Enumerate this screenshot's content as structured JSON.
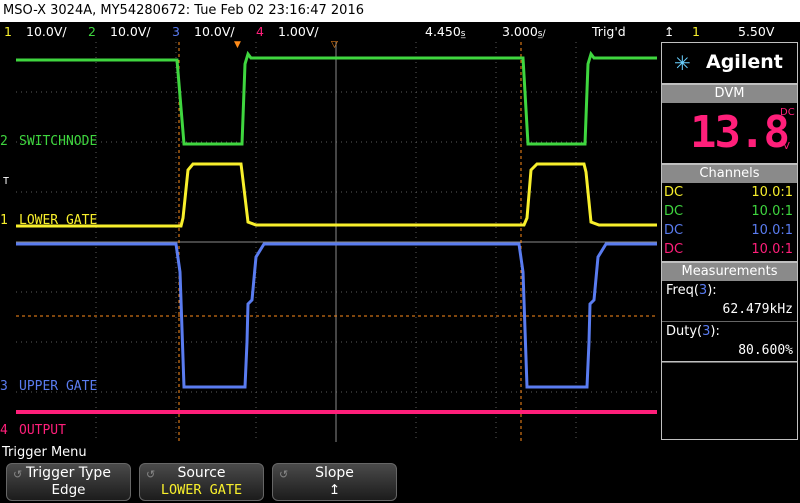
{
  "title": "MSO-X 3024A, MY54280672: Tue Feb 02 23:16:47 2016",
  "status": {
    "ch1": {
      "num": "1",
      "scale": "10.0V/",
      "color": "#f8ef2c"
    },
    "ch2": {
      "num": "2",
      "scale": "10.0V/",
      "color": "#3fd63f"
    },
    "ch3": {
      "num": "3",
      "scale": "10.0V/",
      "color": "#5a7cf0"
    },
    "ch4": {
      "num": "4",
      "scale": "1.00V/",
      "color": "#ff1f7a"
    },
    "time_offset": "4.450",
    "timebase": "3.000",
    "trig_state": "Trig'd",
    "trig_slope_icon": "rising-edge-icon",
    "trig_source": "1",
    "trig_level": "5.50V"
  },
  "channel_labels": {
    "ch2": "SWITCHNODE",
    "ch1": "LOWER GATE",
    "ch3": "UPPER GATE",
    "ch4": "OUTPUT"
  },
  "brand": {
    "name": "Agilent",
    "logo_icon": "agilent-spark-icon"
  },
  "dvm": {
    "header": "DVM",
    "value": "13.8",
    "mode": "DC",
    "unit": "V"
  },
  "channels_panel": {
    "header": "Channels",
    "rows": [
      {
        "coupling": "DC",
        "probe": "10.0:1",
        "color": "#f8ef2c"
      },
      {
        "coupling": "DC",
        "probe": "10.0:1",
        "color": "#3fd63f"
      },
      {
        "coupling": "DC",
        "probe": "10.0:1",
        "color": "#5a7cf0"
      },
      {
        "coupling": "DC",
        "probe": "10.0:1",
        "color": "#ff1f7a"
      }
    ]
  },
  "measurements": {
    "header": "Measurements",
    "items": [
      {
        "name": "Freq(",
        "ch": "3",
        "close": "):",
        "value": "62.479kHz"
      },
      {
        "name": "Duty(",
        "ch": "3",
        "close": "):",
        "value": "80.600%"
      }
    ]
  },
  "softkeys": {
    "menu_title": "Trigger Menu",
    "items": [
      {
        "label": "Trigger Type",
        "value": "Edge",
        "value_color": "#ffffff"
      },
      {
        "label": "Source",
        "value": "LOWER GATE",
        "value_color": "#f8ef2c"
      },
      {
        "label": "Slope",
        "value": "↥",
        "value_color": "#ffffff"
      }
    ]
  }
}
